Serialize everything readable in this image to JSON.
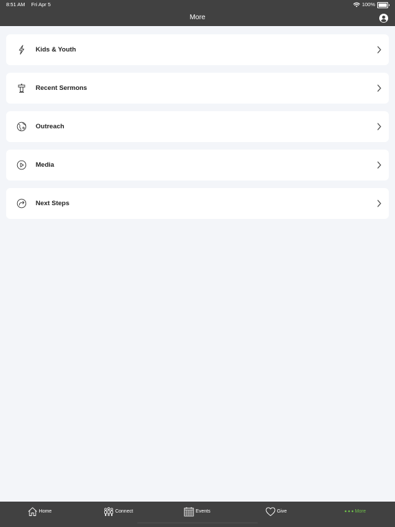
{
  "status_bar": {
    "time": "8:51 AM",
    "date": "Fri Apr 5",
    "battery_text": "100%",
    "battery_level": 1.0
  },
  "nav": {
    "title": "More",
    "profile_icon": "person-circle-icon"
  },
  "items": [
    {
      "label": "Kids & Youth",
      "icon": "lightning-bolt-icon"
    },
    {
      "label": "Recent Sermons",
      "icon": "pulpit-icon"
    },
    {
      "label": "Outreach",
      "icon": "globe-icon"
    },
    {
      "label": "Media",
      "icon": "play-circle-icon"
    },
    {
      "label": "Next Steps",
      "icon": "forward-arrow-circle-icon"
    }
  ],
  "tabs": [
    {
      "label": "Home",
      "icon": "house-icon",
      "active": false
    },
    {
      "label": "Connect",
      "icon": "people-icon",
      "active": false
    },
    {
      "label": "Events",
      "icon": "calendar-icon",
      "active": false
    },
    {
      "label": "Give",
      "icon": "heart-icon",
      "active": false
    },
    {
      "label": "More",
      "icon": "three-dots-icon",
      "active": true
    }
  ],
  "colors": {
    "header_bg": "#414141",
    "background": "#f3f5f9",
    "card_bg": "#ffffff",
    "accent_active": "#6fbf4a",
    "text_primary": "#222222"
  }
}
